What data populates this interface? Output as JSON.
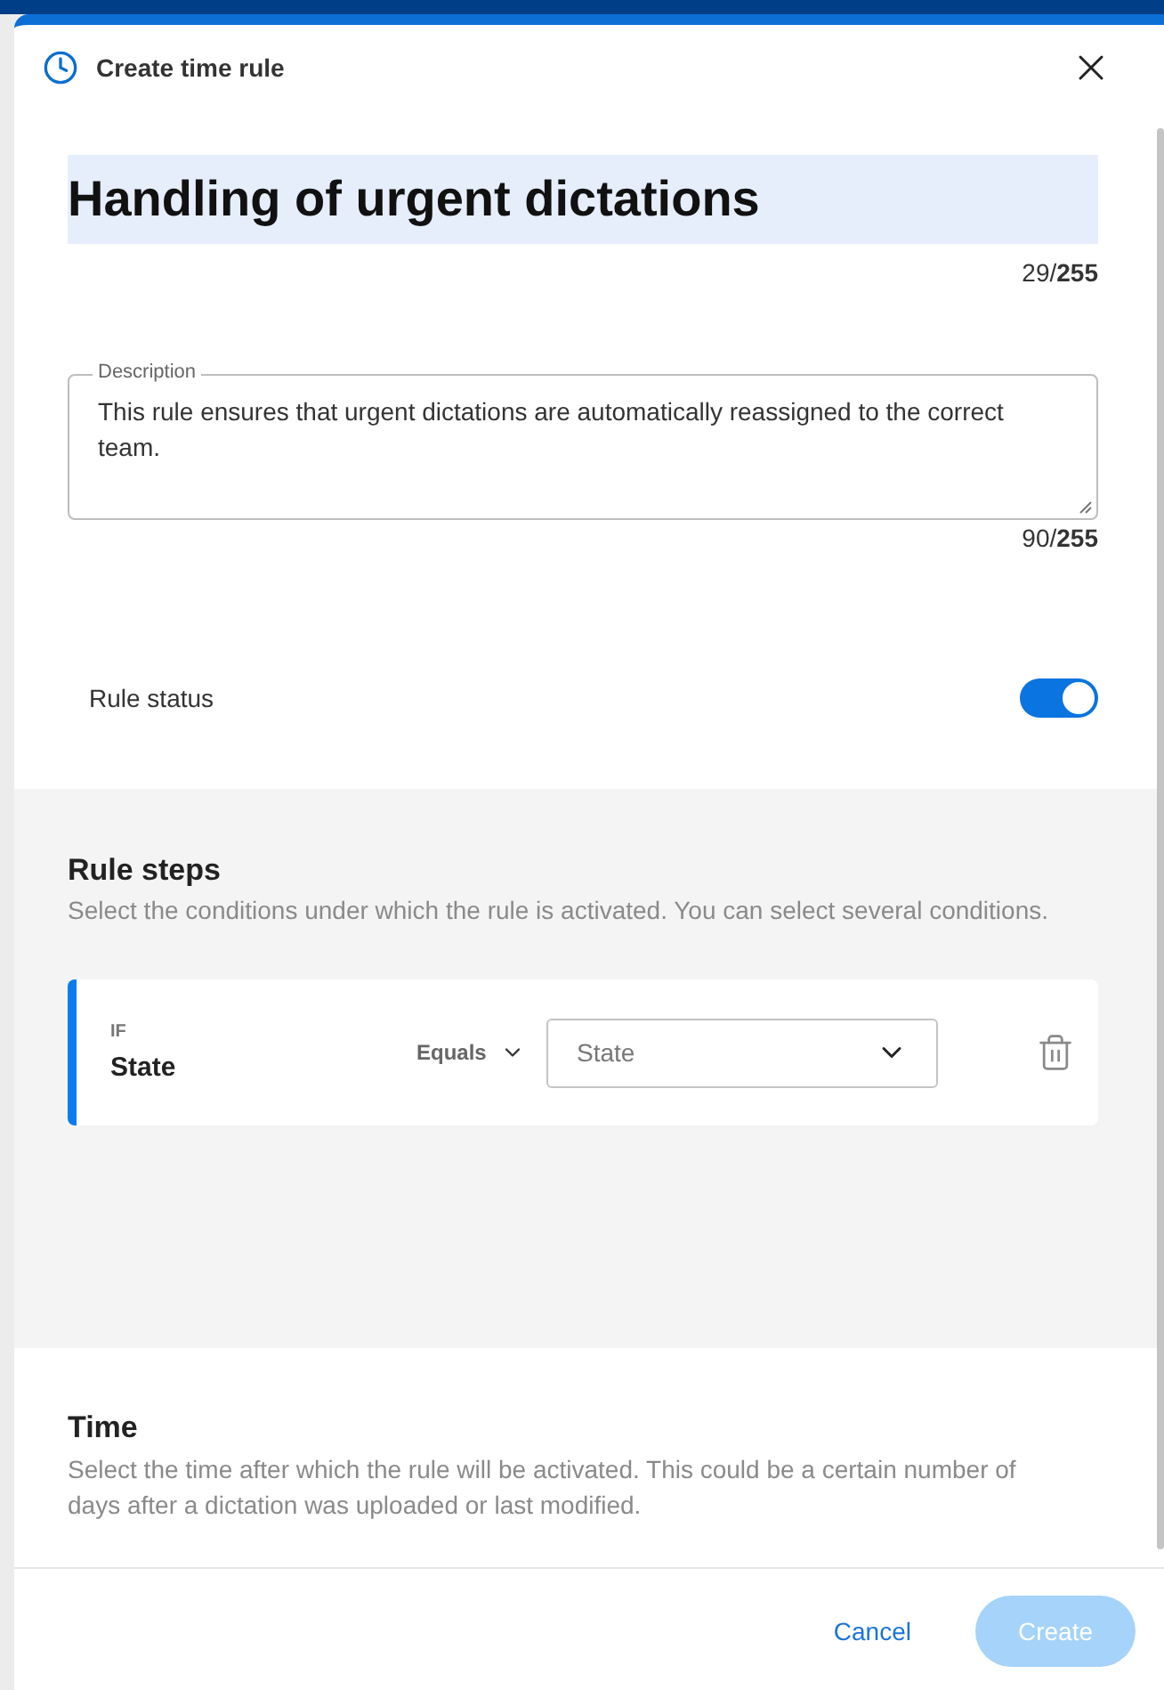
{
  "dialog": {
    "title": "Create time rule"
  },
  "name_field": {
    "value": "Handling of urgent dictations",
    "counter": "29/**255**"
  },
  "description_field": {
    "label": "Description",
    "value": "This rule ensures that urgent dictations are automatically reassigned to the correct team.",
    "counter": "90/**255**"
  },
  "rule_status": {
    "label": "Rule status",
    "on": true
  },
  "rule_steps": {
    "title": "Rule steps",
    "subtitle": "Select the conditions under which the rule is activated. You can select several conditions.",
    "conditions": [
      {
        "prefix": "IF",
        "field": "State",
        "operator": "Equals",
        "value_placeholder": "State"
      }
    ]
  },
  "time": {
    "title": "Time",
    "subtitle": "Select the time after which the rule will be activated. This could be a certain number of days after a dictation was uploaded or last modified."
  },
  "footer": {
    "buttons": [
      {
        "label": "Cancel",
        "kind": "link",
        "disabled": false
      },
      {
        "label": "Create",
        "kind": "primary",
        "disabled": true
      }
    ]
  }
}
